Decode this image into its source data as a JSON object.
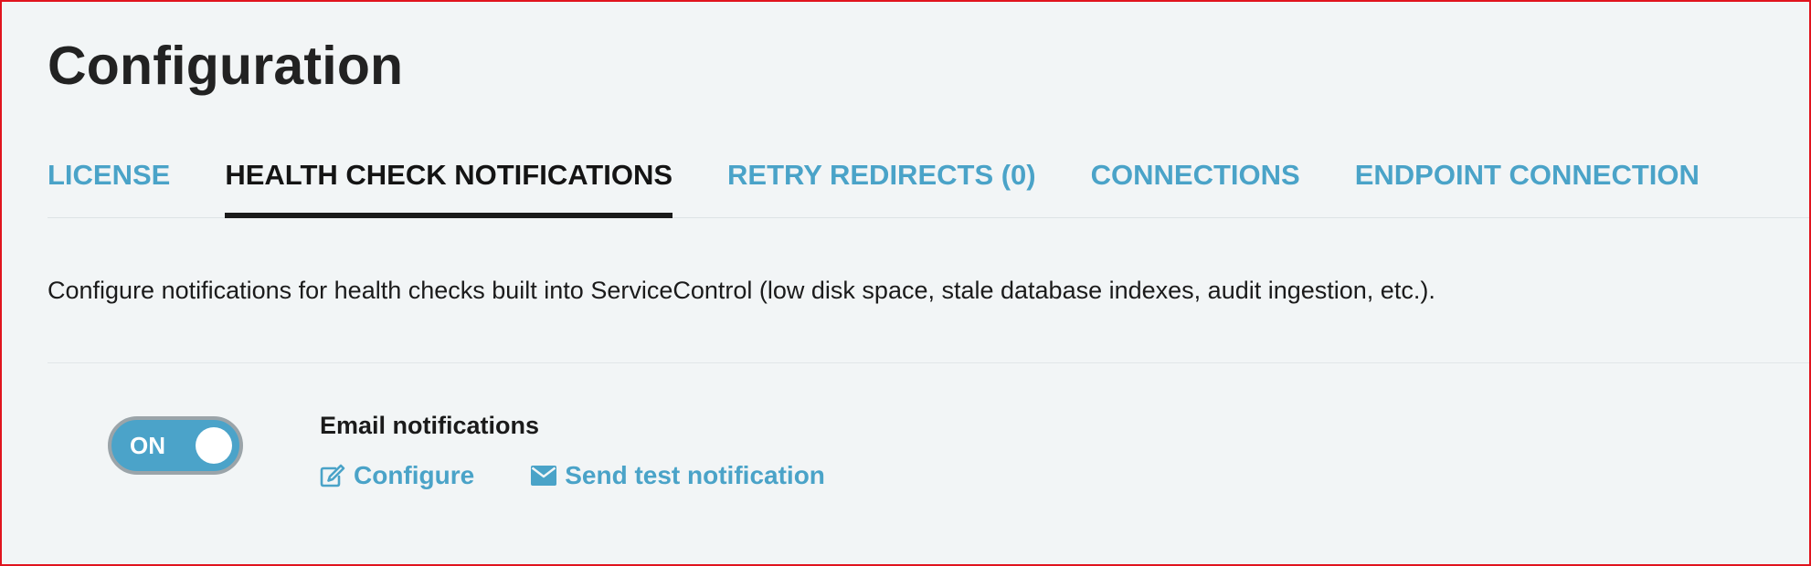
{
  "page": {
    "title": "Configuration"
  },
  "tabs": [
    {
      "label": "LICENSE",
      "active": false
    },
    {
      "label": "HEALTH CHECK NOTIFICATIONS",
      "active": true
    },
    {
      "label": "RETRY REDIRECTS (0)",
      "active": false
    },
    {
      "label": "CONNECTIONS",
      "active": false
    },
    {
      "label": "ENDPOINT CONNECTION",
      "active": false
    }
  ],
  "description": "Configure notifications for health checks built into ServiceControl (low disk space, stale database indexes, audit ingestion, etc.).",
  "email_notifications": {
    "toggle_label": "ON",
    "toggle_on": true,
    "title": "Email notifications",
    "configure": {
      "label": "Configure",
      "icon": "edit-icon"
    },
    "send_test": {
      "label": "Send test notification",
      "icon": "envelope-icon"
    }
  },
  "colors": {
    "accent": "#4aa3c8",
    "active_tab": "#141414",
    "frame_border": "#e0141e",
    "background": "#f2f5f6"
  }
}
